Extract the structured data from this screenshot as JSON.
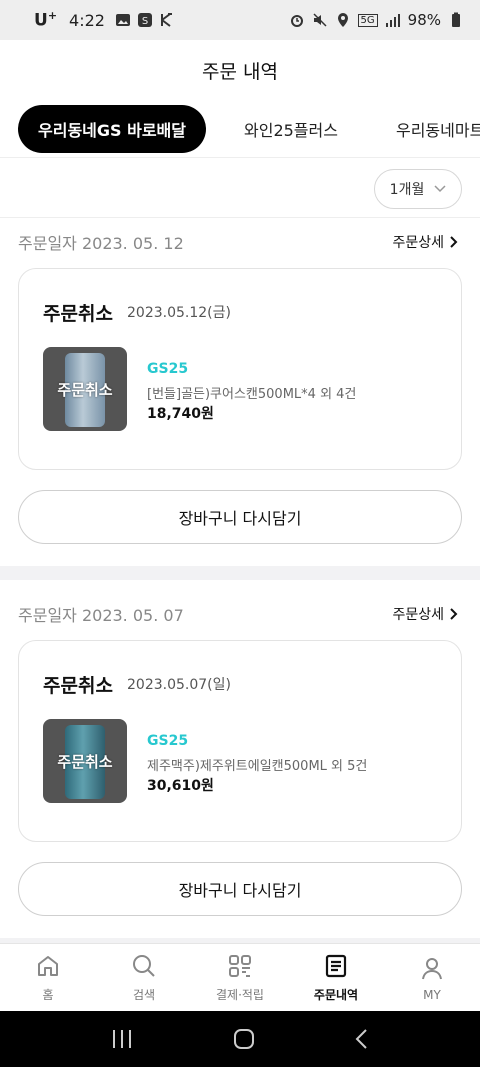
{
  "status_bar": {
    "carrier": "U",
    "carrier_sup": "+",
    "time": "4:22",
    "network": "5G",
    "battery": "98%"
  },
  "header": {
    "title": "주문 내역"
  },
  "tabs": [
    {
      "label": "우리동네GS 바로배달",
      "active": true
    },
    {
      "label": "와인25플러스",
      "active": false
    },
    {
      "label": "우리동네마트 사전",
      "active": false
    }
  ],
  "filter": {
    "period": "1개월"
  },
  "orders": [
    {
      "date_label": "주문일자 2023. 05. 12",
      "detail_label": "주문상세",
      "status": "주문취소",
      "order_date": "2023.05.12(금)",
      "thumb_overlay": "주문취소",
      "store": "GS25",
      "product": "[번들]골든)쿠어스캔500ML*4  외 4건",
      "price": "18,740원",
      "reorder_label": "장바구니 다시담기"
    },
    {
      "date_label": "주문일자 2023. 05. 07",
      "detail_label": "주문상세",
      "status": "주문취소",
      "order_date": "2023.05.07(일)",
      "thumb_overlay": "주문취소",
      "store": "GS25",
      "product": "제주맥주)제주위트에일캔500ML  외 5건",
      "price": "30,610원",
      "reorder_label": "장바구니 다시담기"
    }
  ],
  "bottom_nav": [
    {
      "label": "홈",
      "icon": "home-icon"
    },
    {
      "label": "검색",
      "icon": "search-icon"
    },
    {
      "label": "결제·적립",
      "icon": "grid-pay-icon"
    },
    {
      "label": "주문내역",
      "icon": "order-list-icon",
      "active": true
    },
    {
      "label": "MY",
      "icon": "user-icon"
    }
  ],
  "colors": {
    "accent": "#27c8cf",
    "tab_active_bg": "#000000"
  }
}
